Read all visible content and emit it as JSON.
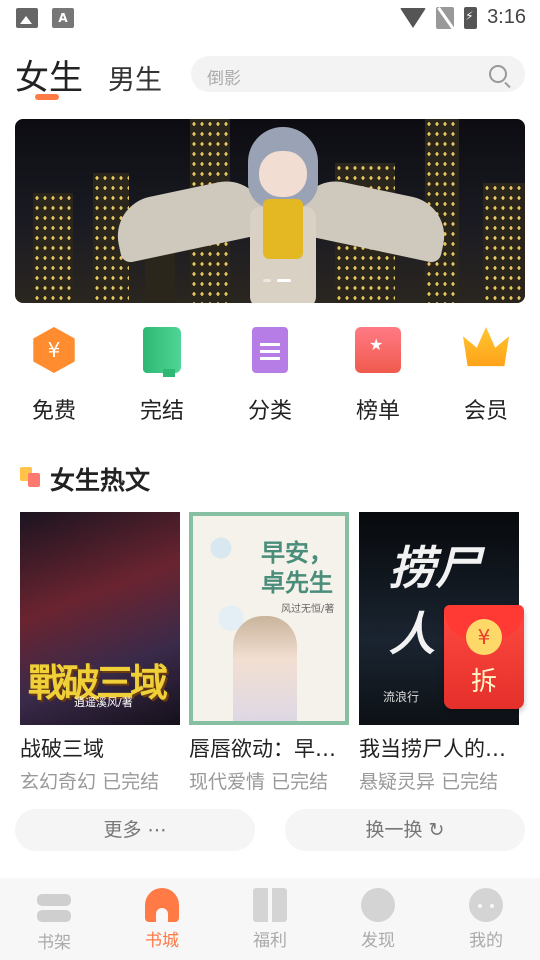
{
  "status_bar": {
    "time": "3:16",
    "left_icons": [
      "image-icon",
      "apk-icon"
    ],
    "apk_glyph": "A",
    "right_icons": [
      "wifi-icon",
      "no-sim-icon",
      "battery-charging-icon"
    ]
  },
  "header": {
    "tabs": [
      {
        "label": "女生",
        "active": true
      },
      {
        "label": "男生",
        "active": false
      }
    ],
    "search": {
      "placeholder": "倒影"
    }
  },
  "banner": {
    "slide_count": 2,
    "active_slide": 1
  },
  "categories": [
    {
      "label": "免费",
      "icon": "coin-hexagon-icon",
      "glyph": "¥"
    },
    {
      "label": "完结",
      "icon": "green-book-icon"
    },
    {
      "label": "分类",
      "icon": "document-list-icon"
    },
    {
      "label": "榜单",
      "icon": "ranking-card-icon"
    },
    {
      "label": "会员",
      "icon": "crown-icon"
    }
  ],
  "section": {
    "title": "女生热文"
  },
  "books": [
    {
      "title": "战破三域",
      "genre": "玄幻奇幻",
      "status": "已完结",
      "cover_title": "戰破三域",
      "cover_author": "逍遥溪风/著"
    },
    {
      "title": "唇唇欲动：早安，卓先生",
      "genre": "现代爱情",
      "status": "已完结",
      "cover_title": "早安，卓先生",
      "cover_author": "风过无恒/著"
    },
    {
      "title": "我当捞尸人的那些年",
      "genre": "悬疑灵异",
      "status": "已完结",
      "cover_title": "捞尸人",
      "cover_author": "流浪行"
    }
  ],
  "red_packet": {
    "coin": "¥",
    "label": "拆"
  },
  "actions": {
    "more": "更多 ⋯",
    "refresh": "换一换 ↻"
  },
  "bottom_nav": [
    {
      "label": "书架",
      "icon": "bookshelf-icon",
      "active": false
    },
    {
      "label": "书城",
      "icon": "bookstore-icon",
      "active": true
    },
    {
      "label": "福利",
      "icon": "gift-icon",
      "active": false
    },
    {
      "label": "发现",
      "icon": "discover-icon",
      "active": false
    },
    {
      "label": "我的",
      "icon": "profile-icon",
      "active": false
    }
  ],
  "colors": {
    "accent": "#ff7a45",
    "red_packet": "#e52f2a"
  }
}
